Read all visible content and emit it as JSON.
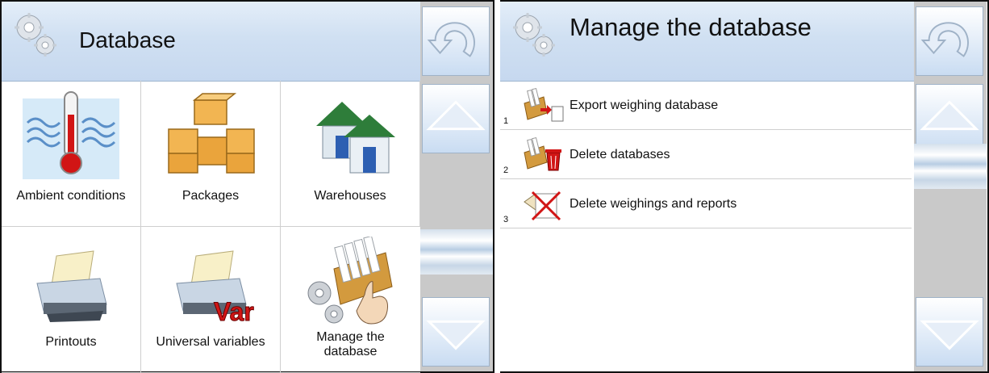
{
  "left": {
    "title": "Database",
    "items": [
      {
        "label": "Ambient conditions"
      },
      {
        "label": "Packages"
      },
      {
        "label": "Warehouses"
      },
      {
        "label": "Printouts"
      },
      {
        "label": "Universal variables",
        "badge": "Var"
      },
      {
        "label_line1": "Manage the",
        "label_line2": "database"
      }
    ]
  },
  "right": {
    "title": "Manage the database",
    "items": [
      {
        "number": "1",
        "label": "Export weighing database"
      },
      {
        "number": "2",
        "label": "Delete databases"
      },
      {
        "number": "3",
        "label": "Delete weighings and reports"
      }
    ]
  },
  "icons": {
    "gear": "gears-icon",
    "back": "back-arrow-icon",
    "up": "scroll-up-icon",
    "down": "scroll-down-icon"
  },
  "colors": {
    "header": "#d0e0f2",
    "scrollbar": "#c9c9c9",
    "button": "#c9dcf2",
    "accent_red": "#d11515"
  }
}
